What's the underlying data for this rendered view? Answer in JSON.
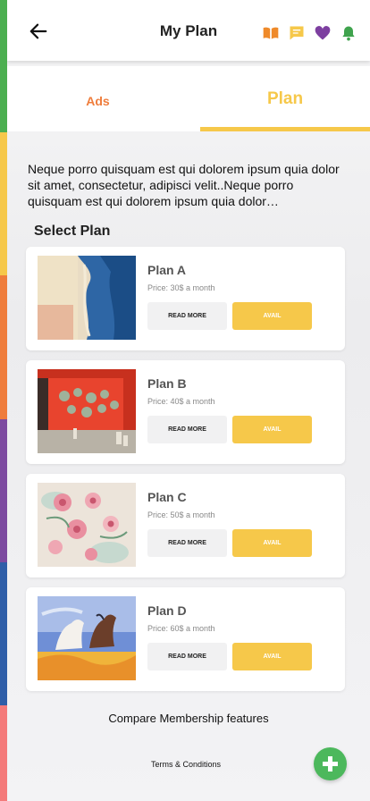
{
  "header": {
    "title": "My Plan",
    "back_icon": "arrow-left-icon",
    "icons": [
      {
        "name": "book-icon",
        "color": "#ef8a2a"
      },
      {
        "name": "chat-icon",
        "color": "#f6c84a"
      },
      {
        "name": "heart-icon",
        "color": "#7d3fa0"
      },
      {
        "name": "bell-icon",
        "color": "#3fa34d"
      }
    ]
  },
  "tabs": {
    "ads": "Ads",
    "plan": "Plan",
    "active": "plan"
  },
  "description": "Neque porro quisquam est qui dolorem ipsum quia dolor sit amet, consectetur, adipisci velit..Neque porro quisquam est qui dolorem ipsum quia dolor…",
  "select_plan_title": "Select Plan",
  "plans": [
    {
      "name": "Plan A",
      "price": "Price: 30$ a month",
      "read_more": "READ MORE",
      "avail": "AVAIL"
    },
    {
      "name": "Plan B",
      "price": "Price: 40$ a month",
      "read_more": "READ MORE",
      "avail": "AVAIL"
    },
    {
      "name": "Plan C",
      "price": "Price: 50$ a month",
      "read_more": "READ MORE",
      "avail": "AVAIL"
    },
    {
      "name": "Plan D",
      "price": "Price: 60$ a month",
      "read_more": "READ MORE",
      "avail": "AVAIL"
    }
  ],
  "compare_link": "Compare Membership features",
  "terms_link": "Terms & Conditions",
  "colors": {
    "accent_yellow": "#f6c84a",
    "accent_orange": "#ef7d3c",
    "fab_green": "#4cb85c"
  }
}
